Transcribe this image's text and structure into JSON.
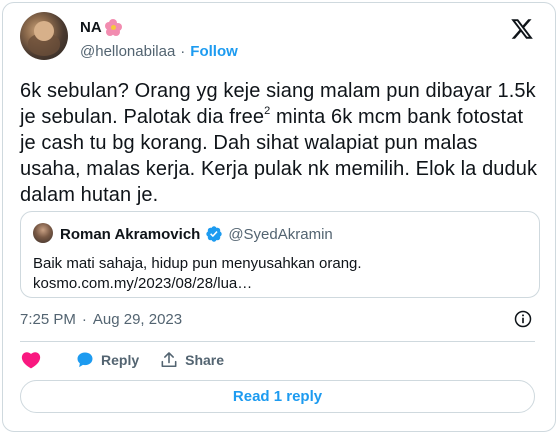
{
  "author": {
    "display_name": "NA",
    "name_emoji_icon": "hibiscus-flower-icon",
    "handle": "@hellonabilaa",
    "separator": "·",
    "follow_label": "Follow"
  },
  "platform_icon": "x-logo-icon",
  "tweet": {
    "text_before_sup": "6k sebulan? Orang yg keje siang malam pun dibayar 1.5k je sebulan. Palotak dia free",
    "sup": "2",
    "text_after_sup": " minta 6k mcm bank fotostat je cash tu bg korang. Dah sihat walapiat pun malas usaha, malas kerja. Kerja pulak nk memilih. Elok la duduk dalam hutan je."
  },
  "quoted": {
    "name": "Roman Akramovich",
    "verified_icon": "verified-badge-icon",
    "handle": "@SyedAkramin",
    "line1": "Baik mati sahaja, hidup pun menyusahkan orang.",
    "line2": "kosmo.com.my/2023/08/28/lua…"
  },
  "meta": {
    "time": "7:25 PM",
    "separator": "·",
    "date": "Aug 29, 2023"
  },
  "actions": {
    "like_icon": "heart-icon",
    "reply_label": "Reply",
    "share_label": "Share"
  },
  "read_replies_label": "Read 1 reply",
  "colors": {
    "accent": "#1d9bf0",
    "like": "#f91880",
    "muted": "#536471",
    "border": "#cfd9de"
  }
}
